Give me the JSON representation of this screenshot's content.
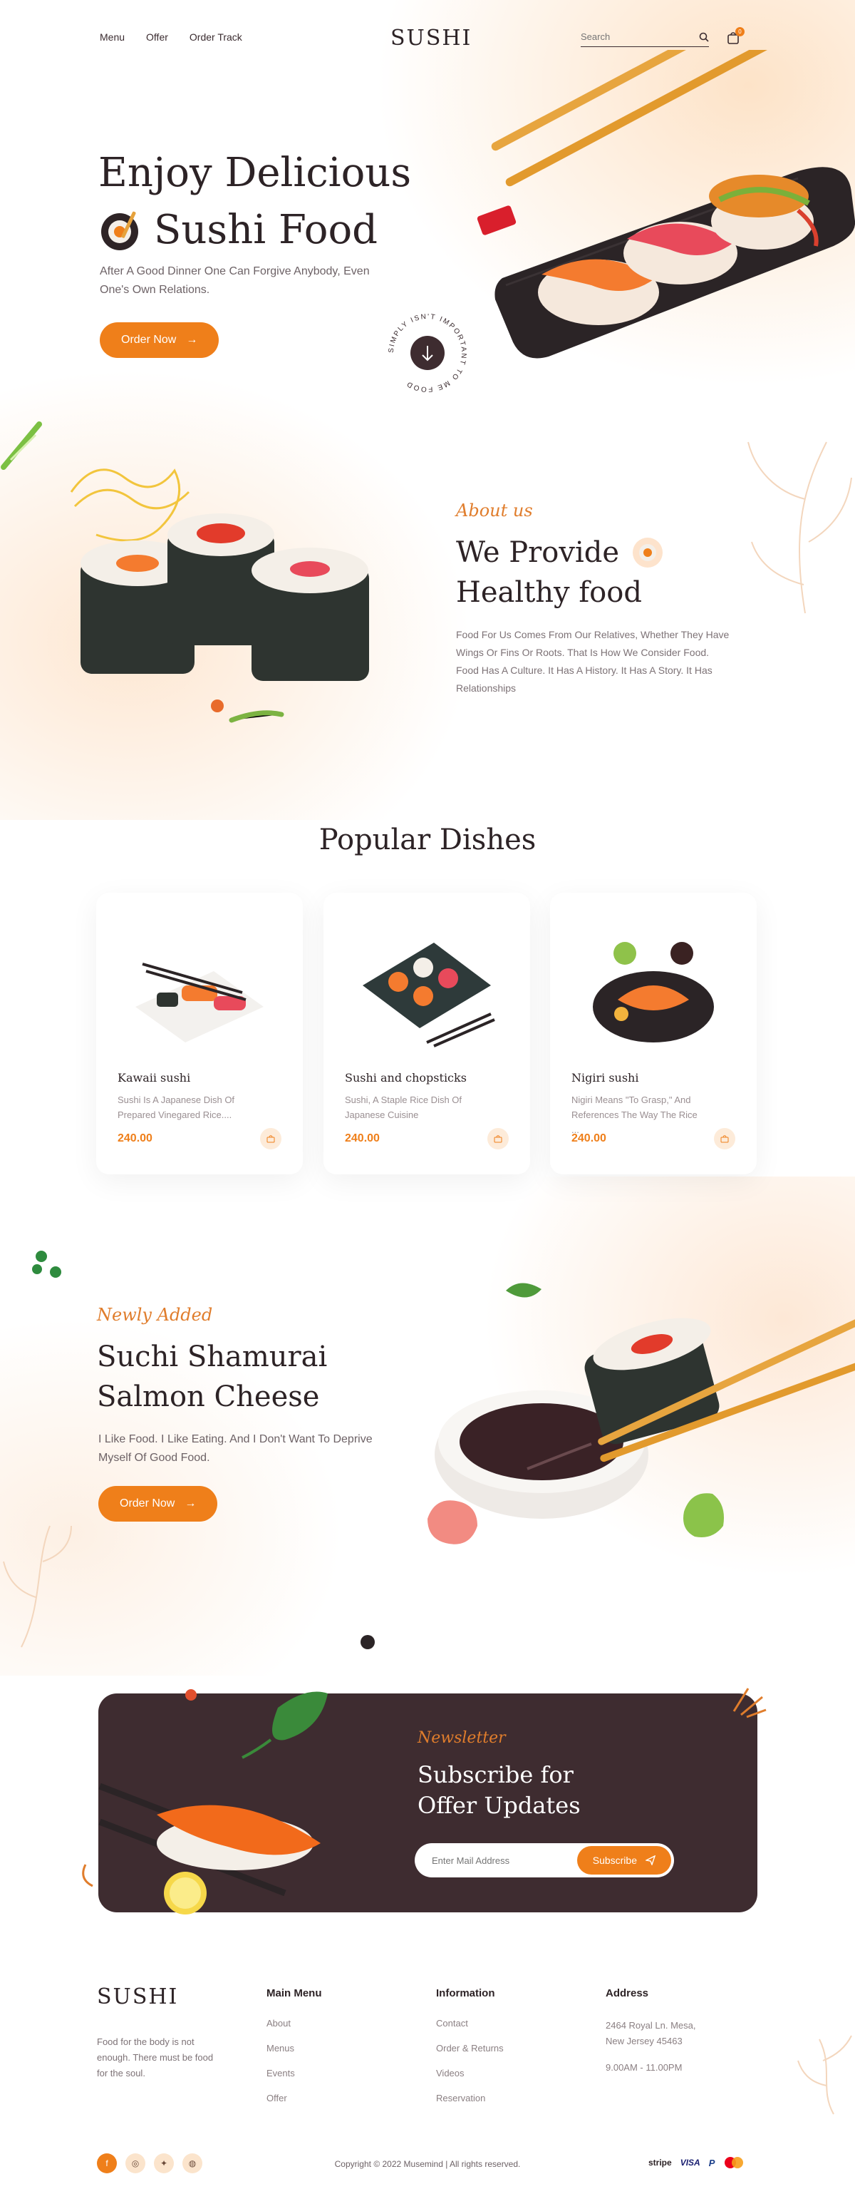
{
  "brand": {
    "logo_text": "SUSHI"
  },
  "nav": {
    "items": [
      "Menu",
      "Offer",
      "Order Track"
    ],
    "search_placeholder": "Search",
    "cart_count": "0"
  },
  "hero": {
    "title_line1": "Enjoy Delicious",
    "title_line2": "Sushi Food",
    "subtitle": "After A Good Dinner One Can Forgive Anybody, Even One's Own Relations.",
    "cta_label": "Order Now",
    "badge_text": "SIMPLY ISN'T IMPORTANT TO ME FOOD"
  },
  "about": {
    "kicker": "About us",
    "title_line1": "We Provide",
    "title_line2": "Healthy food",
    "body": "Food For Us Comes From Our Relatives, Whether They Have Wings Or Fins Or Roots. That Is How We Consider Food. Food Has A Culture. It Has A History. It Has A Story. It Has Relationships"
  },
  "popular": {
    "title": "Popular Dishes",
    "dishes": [
      {
        "name": "Kawaii sushi",
        "desc": "Sushi Is A Japanese Dish Of Prepared Vinegared Rice....",
        "price": "240.00"
      },
      {
        "name": "Sushi and chopsticks",
        "desc": "Sushi, A Staple Rice Dish Of Japanese Cuisine",
        "price": "240.00"
      },
      {
        "name": "Nigiri sushi",
        "desc": "Nigiri Means \"To Grasp,\" And References The Way The Rice ...",
        "price": "240.00"
      }
    ]
  },
  "newly": {
    "kicker": "Newly Added",
    "title_line1": "Suchi Shamurai",
    "title_line2": "Salmon Cheese",
    "body": "I Like Food. I Like Eating. And I Don't Want To Deprive Myself Of Good Food.",
    "cta_label": "Order Now"
  },
  "newsletter": {
    "kicker": "Newsletter",
    "title_line1": "Subscribe for",
    "title_line2": "Offer Updates",
    "input_placeholder": "Enter Mail Address",
    "button_label": "Subscribe"
  },
  "footer": {
    "tagline": "Food for the body is not enough. There must be food for the soul.",
    "main_menu": {
      "title": "Main Menu",
      "links": [
        "About",
        "Menus",
        "Events",
        "Offer"
      ]
    },
    "information": {
      "title": "Information",
      "links": [
        "Contact",
        "Order & Returns",
        "Videos",
        "Reservation"
      ]
    },
    "address": {
      "title": "Address",
      "line1": "2464 Royal Ln. Mesa,",
      "line2": "New Jersey 45463",
      "hours": "9.00AM - 11.00PM"
    },
    "copyright": "Copyright © 2022 Musemind | All rights reserved.",
    "payments": [
      "stripe",
      "VISA",
      "P",
      "mastercard"
    ],
    "socials": [
      "facebook-icon",
      "instagram-icon",
      "twitter-icon",
      "dribbble-icon"
    ]
  },
  "colors": {
    "accent": "#ef7f1a",
    "dark": "#3a2b2f",
    "newsletter_bg": "#3e2c30"
  }
}
